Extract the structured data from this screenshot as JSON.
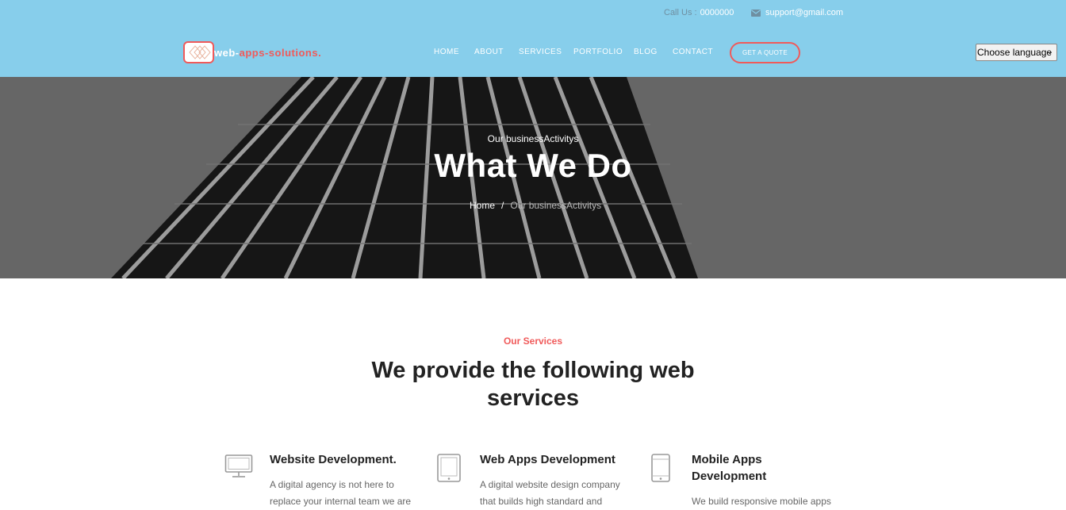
{
  "topbar": {
    "call_label": "Call Us :",
    "call_number": "0000000",
    "email": "support@gmail.com",
    "email_icon": "envelope-icon"
  },
  "brand": {
    "name_part1": "web-",
    "name_part2": "apps-solutions.",
    "accent_color": "#f05a5a",
    "bar_color": "#87ceeb"
  },
  "nav": {
    "items": [
      "HOME",
      "ABOUT",
      "SERVICES",
      "PORTFOLIO",
      "BLOG",
      "CONTACT"
    ],
    "quote_label": "GET A QUOTE"
  },
  "language": {
    "selected": "Choose language"
  },
  "hero": {
    "subtitle": "Our businessActivitys",
    "title": "What We Do",
    "breadcrumb_home": "Home",
    "breadcrumb_separator": "/",
    "breadcrumb_current": "Our businessActivitys"
  },
  "services_section": {
    "kicker": "Our Services",
    "heading": "We provide the following web services",
    "items": [
      {
        "icon": "monitor-icon",
        "title_lines": [
          "Website Development."
        ],
        "desc_lines": [
          "A digital agency is not here to",
          "replace your internal team we are"
        ]
      },
      {
        "icon": "tablet-icon",
        "title_lines": [
          "Web Apps Development"
        ],
        "desc_lines": [
          "A digital website design company",
          "that builds high standard and"
        ]
      },
      {
        "icon": "mobile-icon",
        "title_lines": [
          "Mobile Apps",
          "Development"
        ],
        "desc_lines": [
          "We build responsive mobile apps"
        ]
      }
    ]
  }
}
